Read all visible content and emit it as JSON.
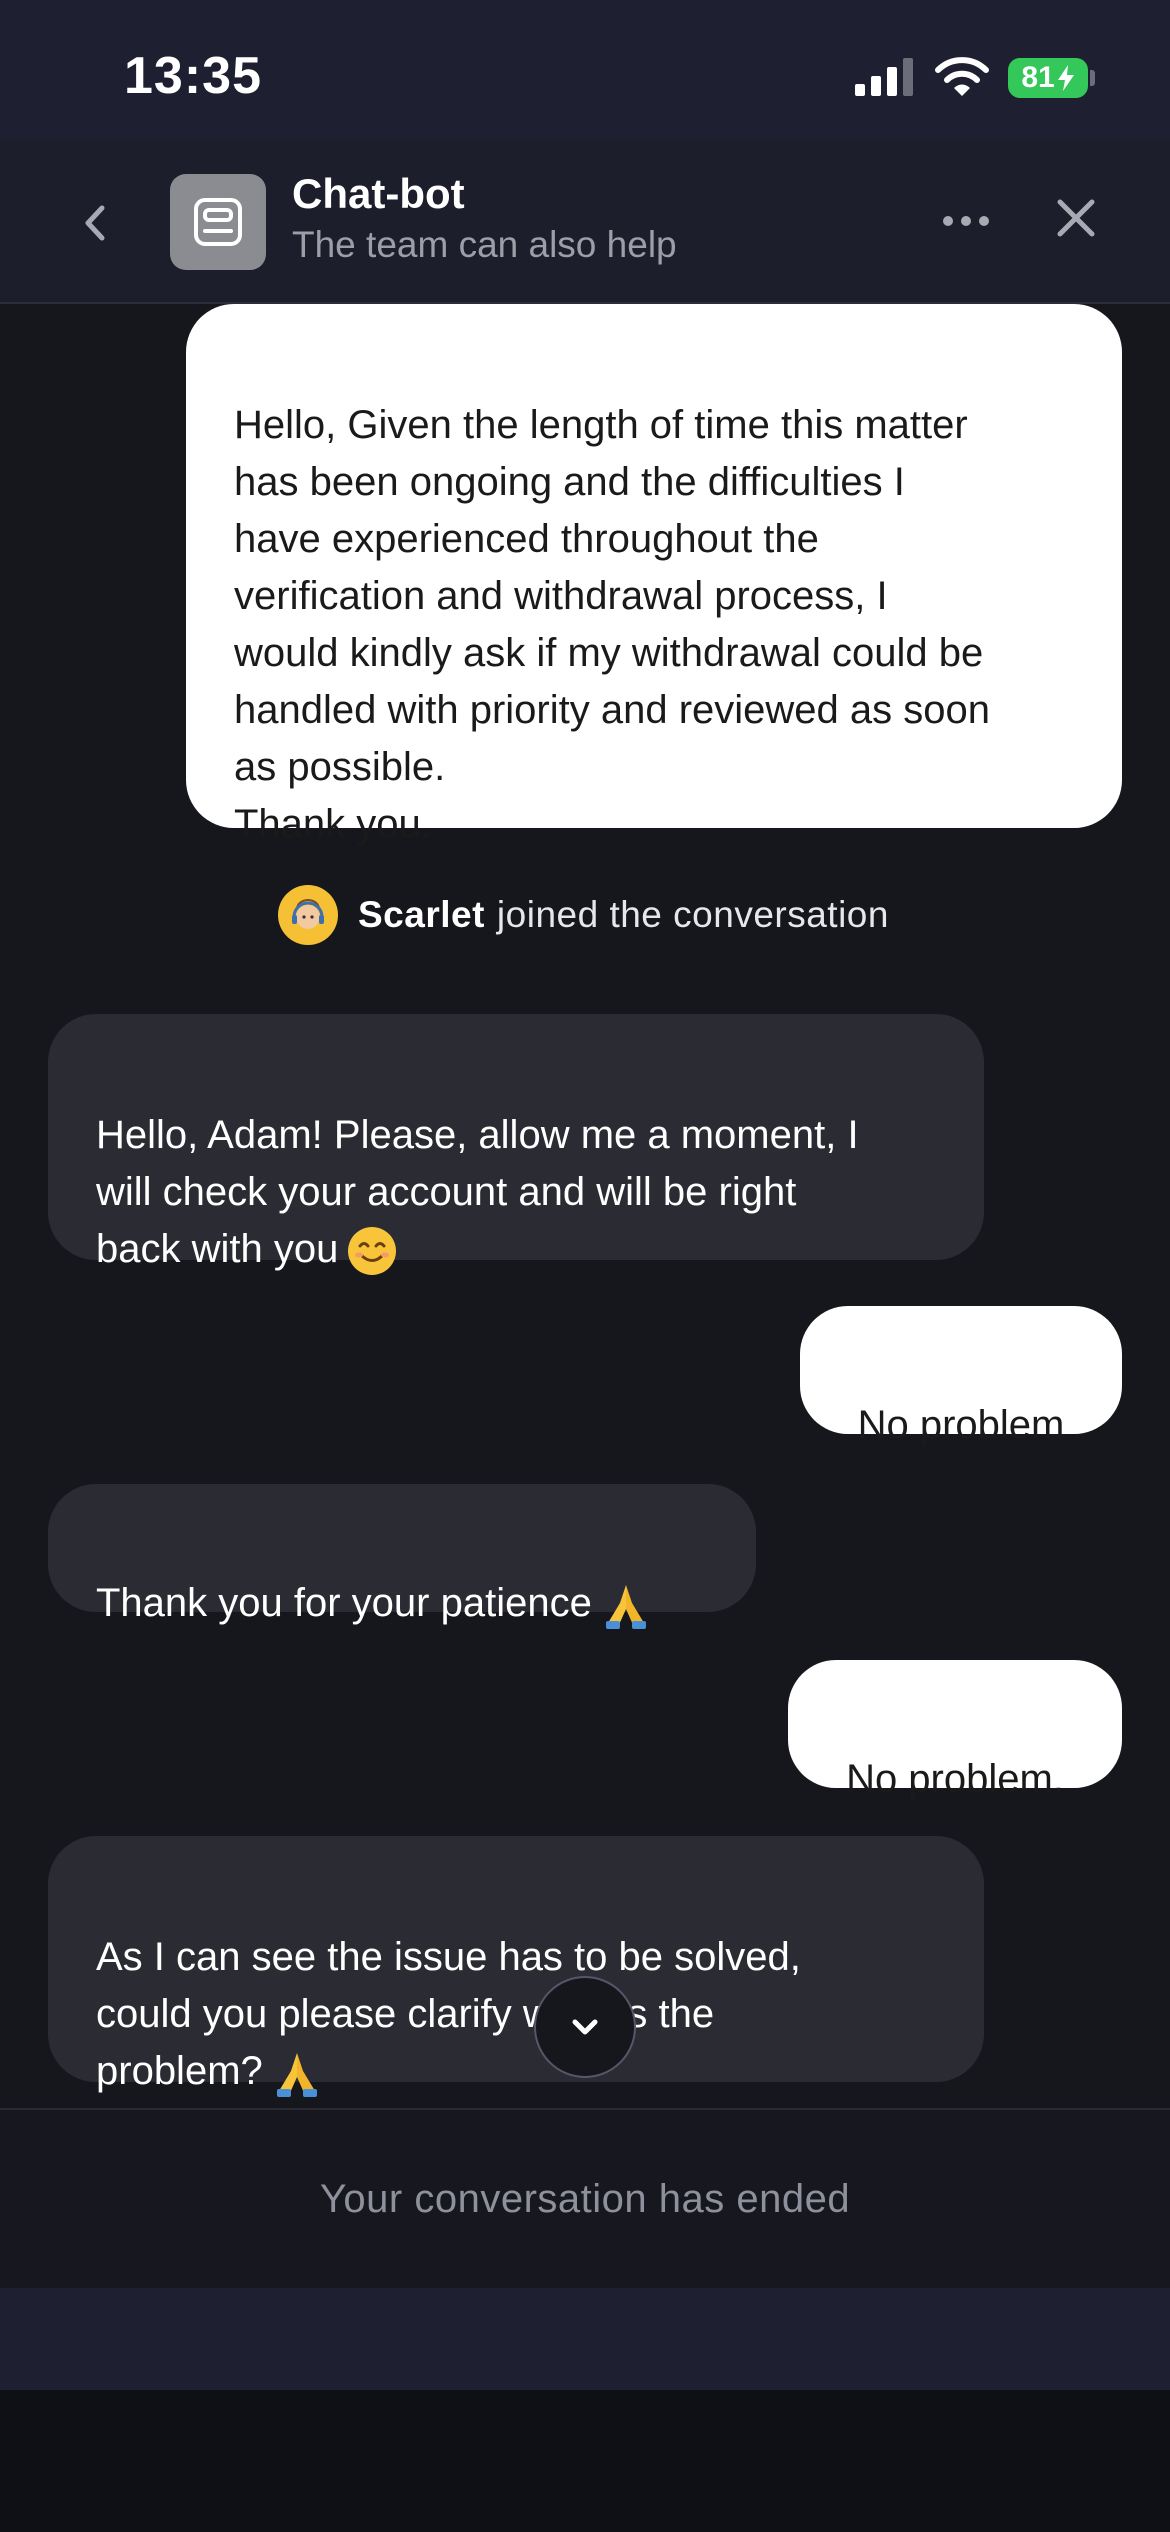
{
  "status_bar": {
    "time": "13:35",
    "battery": "81",
    "icons": [
      "signal-icon",
      "wifi-icon",
      "battery-charging-icon"
    ]
  },
  "header": {
    "title": "Chat-bot",
    "subtitle": "The team can also help",
    "icons": [
      "back-icon",
      "bot-icon",
      "more-icon",
      "close-icon"
    ]
  },
  "messages": [
    {
      "sender": "user",
      "text": "Hello, Given the length of time this matter\nhas been ongoing and the difficulties I\nhave experienced throughout the\nverification and withdrawal process, I\nwould kindly ask if my withdrawal could be\nhandled with priority and reviewed as soon\nas possible.\nThank you."
    },
    {
      "sender": "agent",
      "text": "Hello, Adam! Please, allow me a moment, I\nwill check your account and will be right\nback with you",
      "emoji": "smile-emoji"
    },
    {
      "sender": "user",
      "text": "No problem"
    },
    {
      "sender": "agent",
      "text": "Thank you for your patience",
      "emoji": "pray-emoji"
    },
    {
      "sender": "user",
      "text": "No problem."
    },
    {
      "sender": "agent",
      "text": "As I can see the issue has to be solved,\ncould you please clarify what is the\nproblem?",
      "emoji": "pray-emoji"
    }
  ],
  "joined": {
    "name": "Scarlet",
    "text": "joined the conversation"
  },
  "footer": {
    "ended_text": "Your conversation has ended"
  },
  "colors": {
    "background": "#16171c",
    "header": "#1d1e2b",
    "user_bubble": "#ffffff",
    "agent_bubble": "#2b2c33",
    "battery": "#34c759"
  }
}
